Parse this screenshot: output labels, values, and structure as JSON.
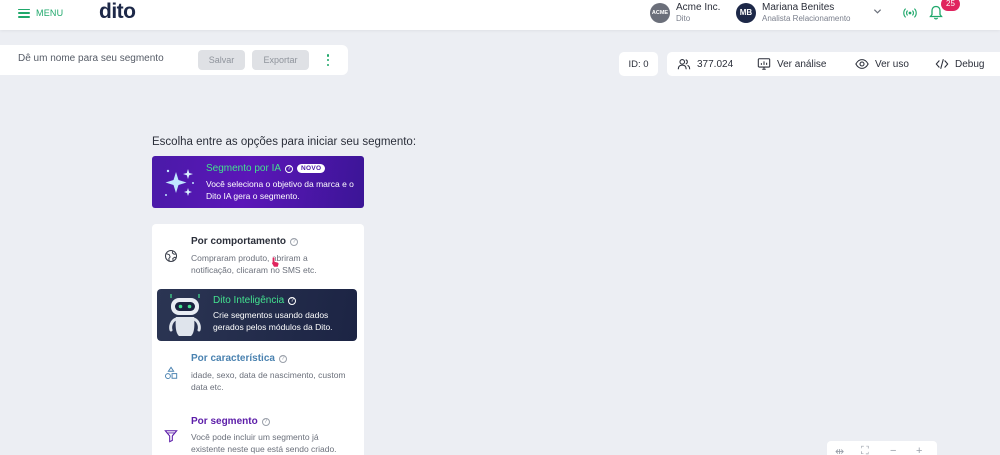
{
  "header": {
    "menu_label": "MENU",
    "logo": "dito",
    "company": {
      "avatar": "ACME",
      "name": "Acme Inc.",
      "sub": "Dito"
    },
    "user": {
      "avatar": "MB",
      "name": "Mariana Benites",
      "sub": "Analista Relacionamento"
    },
    "notifications": "25"
  },
  "segment": {
    "name_placeholder": "Dê um nome para seu segmento",
    "save_label": "Salvar",
    "export_label": "Exportar"
  },
  "toolbar": {
    "id_label": "ID: 0",
    "count": "377.024",
    "analysis_label": "Ver análise",
    "usage_label": "Ver uso",
    "debug_label": "Debug"
  },
  "main": {
    "prompt": "Escolha entre as opções para iniciar seu segmento:",
    "ia": {
      "title": "Segmento por IA",
      "badge": "NOVO",
      "desc": "Você seleciona o objetivo da marca e o Dito IA gera o segmento."
    },
    "options": {
      "behavior": {
        "title": "Por comportamento",
        "desc": "Compraram produto, abriram a notificação, clicaram no SMS etc."
      },
      "dito": {
        "title": "Dito Inteligência",
        "desc": "Crie segmentos usando dados gerados pelos módulos da Dito."
      },
      "characteristic": {
        "title": "Por característica",
        "desc": "idade, sexo, data de nascimento, custom data etc."
      },
      "segment": {
        "title": "Por segmento",
        "desc": "Você pode incluir um segmento já existente neste que está sendo criado."
      }
    }
  },
  "colors": {
    "brand_green": "#1fa86b",
    "ia_purple": "#4a1aa8",
    "navy": "#1d2848",
    "badge_red": "#e0245e"
  },
  "icons": [
    "menu-icon",
    "chevron-down-icon",
    "signal-icon",
    "bell-icon",
    "users-icon",
    "chart-icon",
    "eye-icon",
    "code-icon",
    "sparkles-icon",
    "globe-icon",
    "robot-icon",
    "shapes-icon",
    "filter-icon",
    "kebab-icon"
  ]
}
